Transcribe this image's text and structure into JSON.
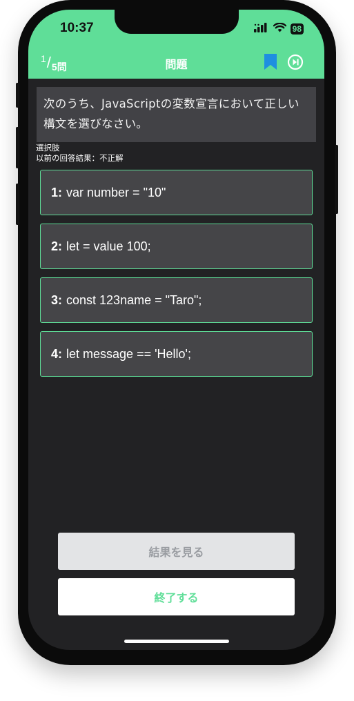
{
  "status_bar": {
    "time": "10:37",
    "battery": "98",
    "icons": [
      "signal-icon",
      "wifi-icon",
      "battery-icon"
    ]
  },
  "header": {
    "counter_current": "1",
    "counter_separator": "/",
    "counter_total": "5問",
    "title": "問題",
    "icons": [
      "bookmark-icon",
      "skip-forward-icon"
    ]
  },
  "question": {
    "text": "次のうち、JavaScriptの変数宣言において正しい構文を選びなさい。"
  },
  "meta": {
    "choices_label": "選択肢",
    "previous_result": "以前の回答結果：不正解"
  },
  "options": [
    {
      "num": "1:",
      "text": "var number = \"10\""
    },
    {
      "num": "2:",
      "text": "let = value 100;"
    },
    {
      "num": "3:",
      "text": "const 123name = \"Taro\";"
    },
    {
      "num": "4:",
      "text": "let message == 'Hello';"
    }
  ],
  "buttons": {
    "see_result": "結果を見る",
    "finish": "終了する"
  },
  "colors": {
    "accent": "#5fde98",
    "bookmark": "#1e8fe0",
    "background": "#222224",
    "card": "#454548"
  }
}
